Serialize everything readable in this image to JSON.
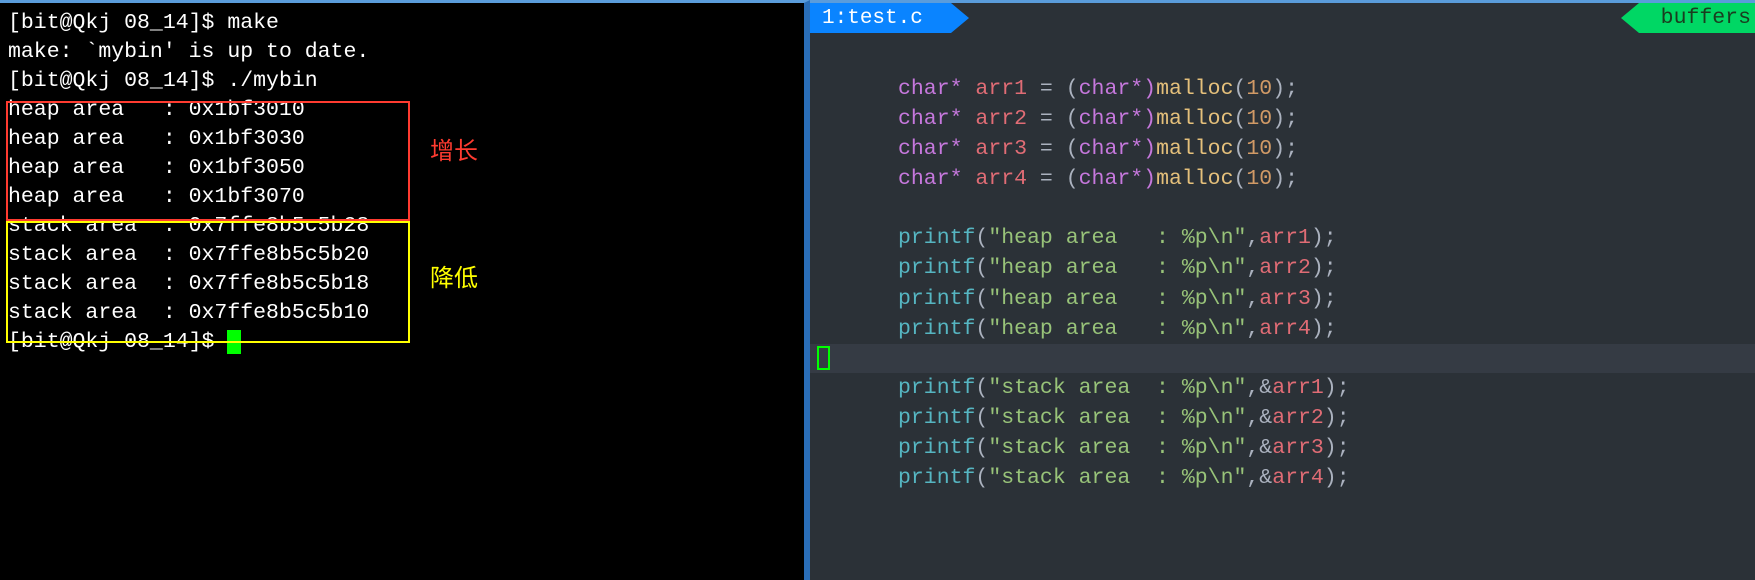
{
  "terminal": {
    "prompt1": "[bit@Qkj 08_14]$ ",
    "cmd1": "make",
    "make_out": "make: `mybin' is up to date.",
    "prompt2": "[bit@Qkj 08_14]$ ",
    "cmd2": "./mybin",
    "heap_lines": [
      "heap area   : 0x1bf3010",
      "heap area   : 0x1bf3030",
      "heap area   : 0x1bf3050",
      "heap area   : 0x1bf3070"
    ],
    "stack_lines": [
      "stack area  : 0x7ffe8b5c5b28",
      "stack area  : 0x7ffe8b5c5b20",
      "stack area  : 0x7ffe8b5c5b18",
      "stack area  : 0x7ffe8b5c5b10"
    ],
    "prompt3": "[bit@Qkj 08_14]$ ",
    "annotation_growth": "增长",
    "annotation_decrease": "降低"
  },
  "editor": {
    "tab_number": "1: ",
    "tab_name": "test.c",
    "buffers_label": "buffers",
    "code": {
      "char_kw": "char",
      "star": "*",
      "eq": " = ",
      "open": "(",
      "close": ")",
      "cast_close": "*)",
      "semi": ";",
      "malloc": "malloc",
      "printf": "printf",
      "ten": "10",
      "arr1": "arr1",
      "arr2": "arr2",
      "arr3": "arr3",
      "arr4": "arr4",
      "amp": "&",
      "comma": ",",
      "heap_str": "\"heap area   : %p\\n\"",
      "stack_str": "\"stack area  : %p\\n\""
    }
  }
}
